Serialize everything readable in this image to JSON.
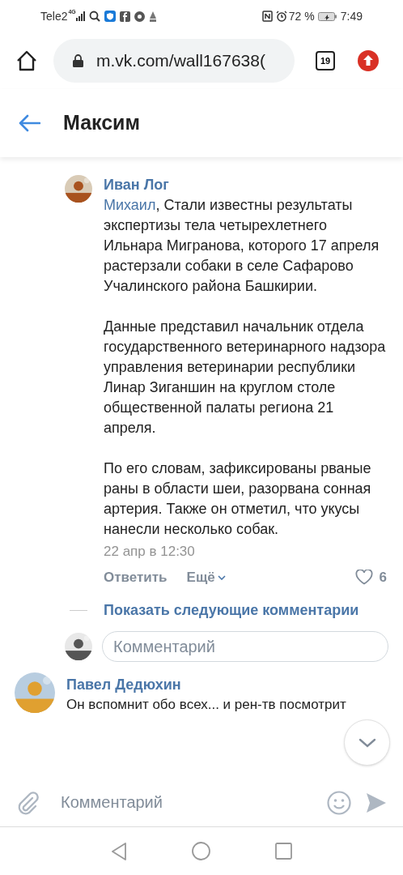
{
  "status_bar": {
    "carrier": "Tele2",
    "network": "4G",
    "battery": "72 %",
    "time": "7:49"
  },
  "browser": {
    "url": "m.vk.com/wall167638(",
    "tabs_count": "19"
  },
  "header": {
    "title": "Максим"
  },
  "comment": {
    "author": "Иван Лог",
    "mention": "Михаил",
    "paragraphs": [
      ", Стали известны результаты экспертизы тела четырехлетнего Ильнара Мигранова, которого 17 апреля растерзали собаки в селе Сафарово Учалинского района Башкирии.",
      "Данные представил начальник отдела государственного ветеринарного надзора управления ветеринарии республики Линар Зиганшин на круглом столе общественной палаты региона 21 апреля.",
      "По его словам, зафиксированы рваные раны в области шеи, разорвана сонная артерия. Также он отметил, что укусы нанесли несколько собак."
    ],
    "date": "22 апр в 12:30",
    "reply": "Ответить",
    "more": "Ещё",
    "likes": "6",
    "liked": false
  },
  "show_more": "Показать следующие комментарии",
  "reply_field": {
    "placeholder": "Комментарий"
  },
  "next_comment": {
    "author": "Павел Дедюхин",
    "text": "Он вспомнит обо всех... и рен-тв посмотрит"
  },
  "compose": {
    "placeholder": "Комментарий"
  }
}
